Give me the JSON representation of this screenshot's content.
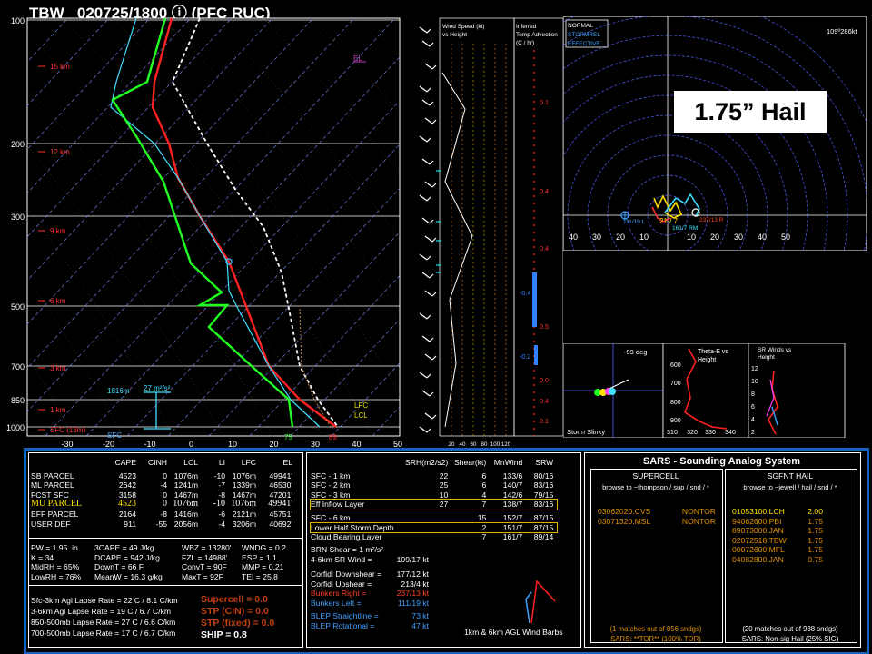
{
  "header": {
    "station": "TBW",
    "datetime": "020725/1800",
    "source": "ⓘ (PFC RUC)"
  },
  "callout": {
    "text": "1.75” Hail"
  },
  "skewt": {
    "pressure_labels": [
      "100",
      "200",
      "300",
      "500",
      "700",
      "850",
      "1000"
    ],
    "height_labels": [
      "15 km",
      "12 km",
      "9 km",
      "6 km",
      "3 km",
      "1 km",
      "SFC (13m)"
    ],
    "temp_labels": [
      "-30",
      "-20",
      "-10",
      "0",
      "10",
      "20",
      "30",
      "40",
      "50"
    ],
    "annotations": {
      "el": "EL",
      "lfc": "LFC",
      "lcl": "LCL",
      "sfc": "SFC",
      "srh_height": "1816m",
      "srh_value": "27 m²/s²",
      "temp_surface": "89",
      "dewpoint_surface": "75"
    }
  },
  "wind_panel": {
    "title_line1": "Wind Speed (kt)",
    "title_line2": "vs Height",
    "axis": [
      "20",
      "40",
      "60",
      "80",
      "100",
      "120"
    ]
  },
  "temp_adv": {
    "title_line1": "Inferred",
    "title_line2": "Temp Advection",
    "title_line3": "(C / hr)",
    "values": [
      "0.1",
      "0.4",
      "0.4",
      "-0.4",
      "0.5",
      "-0.2",
      "0.0",
      "0.4",
      "0.1"
    ]
  },
  "hodograph": {
    "legend": [
      "NORMAL",
      "STORMREL",
      "EFFECTIVE"
    ],
    "scale": "109º286kt",
    "axis": [
      "40",
      "30",
      "20",
      "10",
      "10",
      "20",
      "30",
      "40",
      "50"
    ],
    "labels": {
      "left_mover": "111/19 L",
      "bunkers": "21 / 7",
      "right_mover": "237/13 R",
      "mean": "161/7 RM"
    }
  },
  "small_panels": {
    "slinky": {
      "angle": "-99 deg",
      "title": "Storm Slinky"
    },
    "thetae": {
      "title_line1": "Theta-E vs",
      "title_line2": "Height",
      "x_axis": [
        "310",
        "320",
        "330",
        "340"
      ],
      "y_axis": [
        "600",
        "700",
        "800",
        "900"
      ]
    },
    "srwinds": {
      "title_line1": "SR Winds vs",
      "title_line2": "Height",
      "y_axis": [
        "12",
        "10",
        "8",
        "6",
        "4",
        "2"
      ]
    }
  },
  "parcels": {
    "headers": [
      "CAPE",
      "CINH",
      "LCL",
      "LI",
      "LFC",
      "EL"
    ],
    "rows": [
      {
        "name": "SB PARCEL",
        "cape": "4523",
        "cinh": "0",
        "lcl": "1076m",
        "li": "-10",
        "lfc": "1076m",
        "el": "49941'"
      },
      {
        "name": "ML PARCEL",
        "cape": "2642",
        "cinh": "-4",
        "lcl": "1241m",
        "li": "-7",
        "lfc": "1339m",
        "el": "46530'"
      },
      {
        "name": "FCST SFC",
        "cape": "3158",
        "cinh": "0",
        "lcl": "1467m",
        "li": "-8",
        "lfc": "1467m",
        "el": "47201'"
      },
      {
        "name": "MU PARCEL",
        "cape": "4523",
        "cinh": "0",
        "lcl": "1076m",
        "li": "-10",
        "lfc": "1076m",
        "el": "49941'"
      },
      {
        "name": "EFF PARCEL",
        "cape": "2164",
        "cinh": "-8",
        "lcl": "1416m",
        "li": "-6",
        "lfc": "2121m",
        "el": "45751'"
      },
      {
        "name": "USER DEF",
        "cape": "911",
        "cinh": "-55",
        "lcl": "2056m",
        "li": "-4",
        "lfc": "3206m",
        "el": "40692'"
      }
    ]
  },
  "indices": {
    "col1": [
      "PW = 1.95 .in",
      "K = 34",
      "MidRH = 65%",
      "LowRH = 76%"
    ],
    "col2": [
      "3CAPE = 49 J/kg",
      "DCAPE = 942 J/kg",
      "DownT = 66 F",
      "MeanW = 16.3 g/kg"
    ],
    "col3": [
      "WBZ = 13280'",
      "FZL = 14988'",
      "ConvT = 90F",
      "MaxT = 92F"
    ],
    "col4": [
      "WNDG = 0.2",
      "ESP = 1.1",
      "MMP = 0.21",
      "TEI = 25.8"
    ]
  },
  "lapse": [
    "Sfc-3km Agl Lapse Rate = 22 C / 8.1 C/km",
    "3-6km Agl Lapse Rate = 19 C / 6.7 C/km",
    "850-500mb Lapse Rate = 27 C / 6.6 C/km",
    "700-500mb Lapse Rate = 17 C / 6.7 C/km"
  ],
  "composites": [
    "Supercell = 0.0",
    "STP (CIN) = 0.0",
    "STP (fixed) = 0.0",
    "SHIP = 0.8"
  ],
  "kinematics": {
    "headers": [
      "SRH(m2/s2)",
      "Shear(kt)",
      "MnWind",
      "SRW"
    ],
    "rows": [
      {
        "name": "SFC - 1 km",
        "srh": "22",
        "shear": "6",
        "mn": "133/6",
        "srw": "80/16"
      },
      {
        "name": "SFC - 2 km",
        "srh": "25",
        "shear": "6",
        "mn": "140/7",
        "srw": "83/16"
      },
      {
        "name": "SFC - 3 km",
        "srh": "10",
        "shear": "4",
        "mn": "142/6",
        "srw": "79/15"
      },
      {
        "name": "Eff Inflow Layer",
        "srh": "27",
        "shear": "7",
        "mn": "138/7",
        "srw": "83/16"
      },
      {
        "name": "SFC - 6 km",
        "srh": "",
        "shear": "15",
        "mn": "152/7",
        "srw": "87/15"
      },
      {
        "name": "Lower Half Storm Depth",
        "srh": "",
        "shear": "2",
        "mn": "151/7",
        "srw": "87/15"
      },
      {
        "name": "Cloud Bearing Layer",
        "srh": "",
        "shear": "7",
        "mn": "161/7",
        "srw": "89/14"
      }
    ],
    "brn": "BRN Shear = 1 m²/s²",
    "srwind": [
      "4-6km SR Wind =",
      "109/17 kt"
    ],
    "corfidi": [
      [
        "Corfidi Downshear =",
        "177/12 kt"
      ],
      [
        "Corfidi Upshear =",
        "213/4 kt"
      ]
    ],
    "bunkers": [
      [
        "Bunkers Right =",
        "237/13 kt"
      ],
      [
        "Bunkers Left =",
        "111/19 kt"
      ]
    ],
    "blep": [
      [
        "BLEP Straightline =",
        "73 kt"
      ],
      [
        "BLEP Rotational =",
        "47 kt"
      ]
    ],
    "barbs_caption": "1km & 6km AGL Wind Barbs"
  },
  "sars": {
    "title": "SARS - Sounding Analog System",
    "supercell": {
      "heading": "SUPERCELL",
      "browse": "browse to ~thompson / sup / snd / *",
      "matches": [
        {
          "date": "03062020.CVS",
          "result": "NONTOR"
        },
        {
          "date": "03071320.MSL",
          "result": "NONTOR"
        }
      ],
      "count": "(1 matches out of 856 sndgs)",
      "summary": "SARS: **TOR** (100% TOR)"
    },
    "hail": {
      "heading": "SGFNT HAIL",
      "browse": "browse to ~jewell / hail / snd / *",
      "matches": [
        {
          "date": "01053100.LCH",
          "size": "2.00"
        },
        {
          "date": "94062600.PBI",
          "size": "1.75"
        },
        {
          "date": "89073000.JAN",
          "size": "1.75"
        },
        {
          "date": "02072518.TBW",
          "size": "1.75"
        },
        {
          "date": "00072600.MFL",
          "size": "1.75"
        },
        {
          "date": "04082800.JAN",
          "size": "0.75"
        }
      ],
      "count": "(20 matches out of 938 sndgs)",
      "summary": "SARS: Non-sig Hail (25% SIG)"
    }
  },
  "colors": {
    "temperature": "#ff2020",
    "dewpoint": "#20ff20",
    "wetbulb": "#40e0ff",
    "parcel": "#ffffff",
    "frame": "#1565c0",
    "highlight": "#e0b000",
    "bunkers": "#ff4020"
  }
}
